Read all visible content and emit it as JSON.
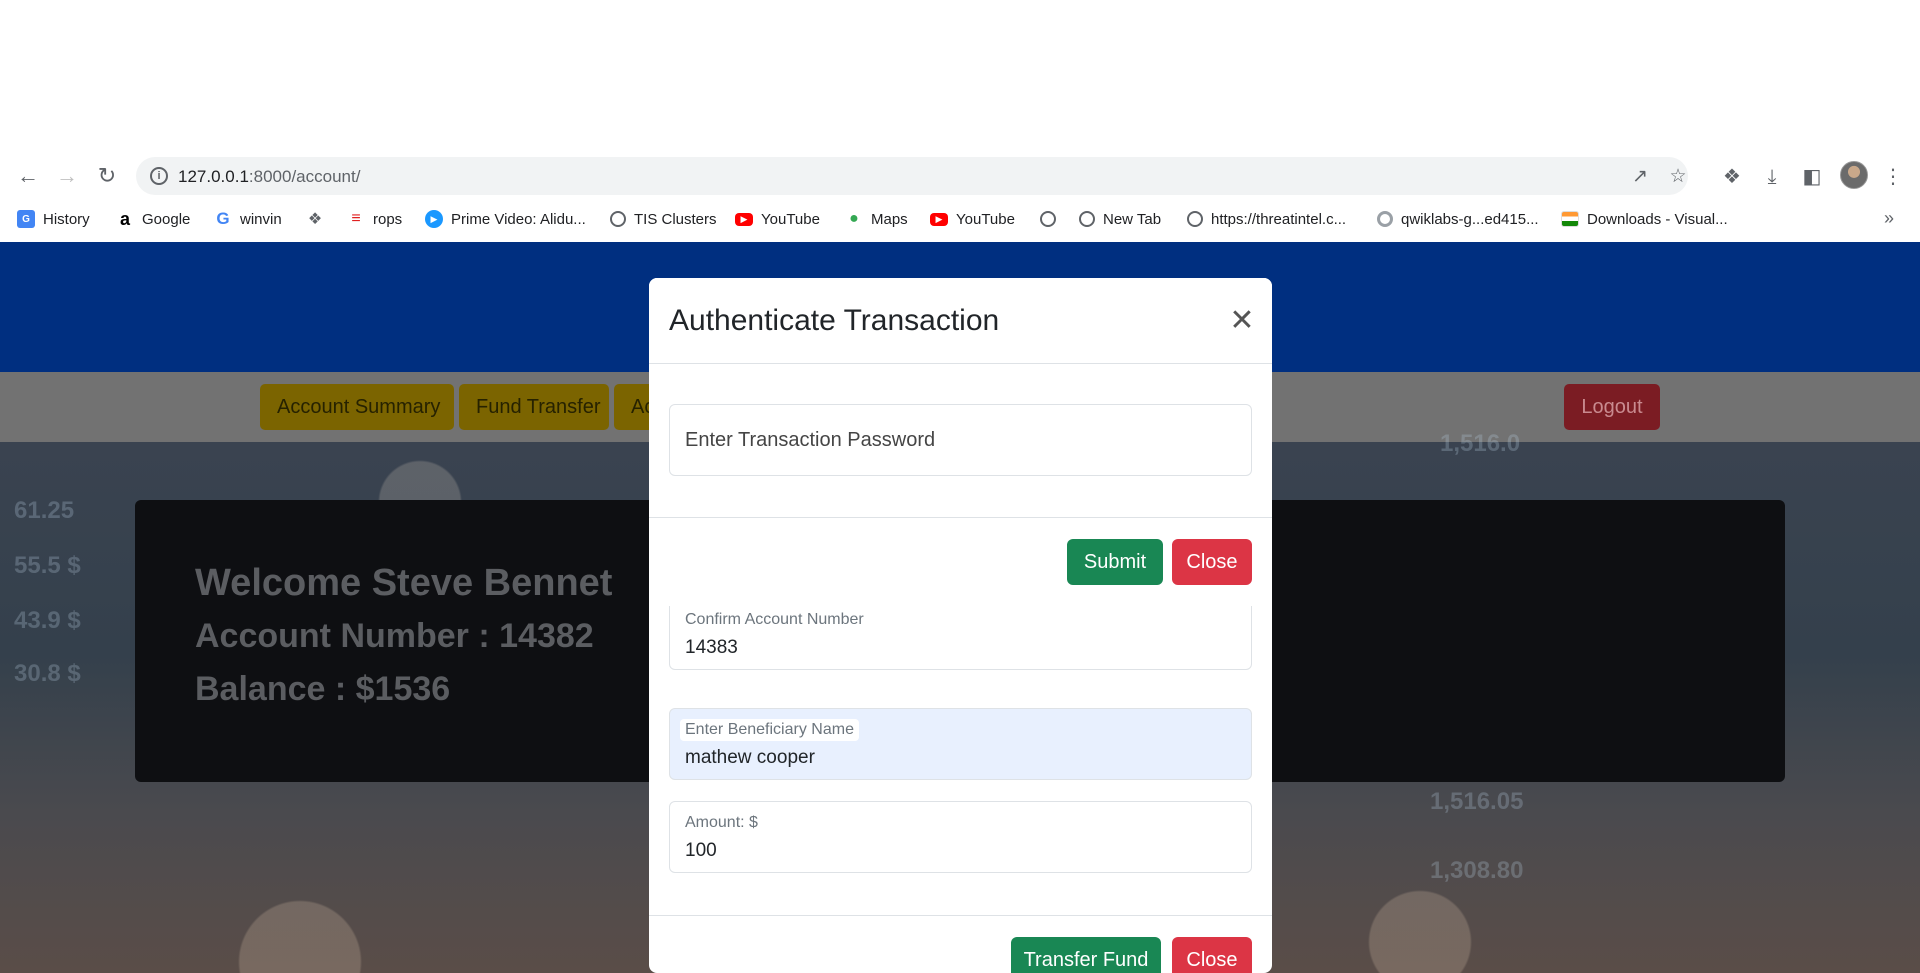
{
  "browser": {
    "url_host": "127.0.0.1",
    "url_rest": ":8000/account/",
    "bookmarks": [
      {
        "label": "History",
        "icon": "history-icon"
      },
      {
        "label": "Google",
        "icon": "amazon-icon"
      },
      {
        "label": "winvin",
        "icon": "google-icon"
      },
      {
        "label": "",
        "icon": "puzzle-icon"
      },
      {
        "label": "rops",
        "icon": "rops-icon"
      },
      {
        "label": "Prime Video: Alidu...",
        "icon": "prime-video-icon"
      },
      {
        "label": "TIS Clusters",
        "icon": "globe-icon"
      },
      {
        "label": "YouTube",
        "icon": "youtube-icon"
      },
      {
        "label": "Maps",
        "icon": "maps-icon"
      },
      {
        "label": "YouTube",
        "icon": "youtube-icon"
      },
      {
        "label": "",
        "icon": "globe-icon"
      },
      {
        "label": "New Tab",
        "icon": "globe-icon"
      },
      {
        "label": "https://threatintel.c...",
        "icon": "globe-icon"
      },
      {
        "label": "qwiklabs-g...ed415...",
        "icon": "chrome-icon"
      },
      {
        "label": "Downloads - Visual...",
        "icon": "india-flag-icon"
      }
    ]
  },
  "nav": {
    "account_summary": "Account Summary",
    "fund_transfer": "Fund Transfer",
    "third_partial": "Ac",
    "logout": "Logout"
  },
  "welcome": {
    "greeting": "Welcome Steve Bennet",
    "account_number": "Account Number : 14382",
    "balance": "Balance : $1536"
  },
  "background_ghost_numbers": [
    "61.25",
    "55.5 $",
    "43.9 $",
    "30.8 $",
    "1,516.05",
    "1,308.80",
    "1,516.0"
  ],
  "transfer_modal": {
    "confirm_account_label": "Confirm Account Number",
    "confirm_account_value": "14383",
    "beneficiary_label": "Enter Beneficiary Name",
    "beneficiary_value": "mathew cooper",
    "amount_label": "Amount: $",
    "amount_value": "100",
    "transfer_button": "Transfer Fund",
    "close_button": "Close"
  },
  "auth_modal": {
    "title": "Authenticate Transaction",
    "password_placeholder": "Enter Transaction Password",
    "submit_button": "Submit",
    "close_button": "Close"
  },
  "colors": {
    "banner": "#002f80",
    "success": "#198754",
    "danger": "#dc3545",
    "nav_pill": "#ffc107"
  }
}
